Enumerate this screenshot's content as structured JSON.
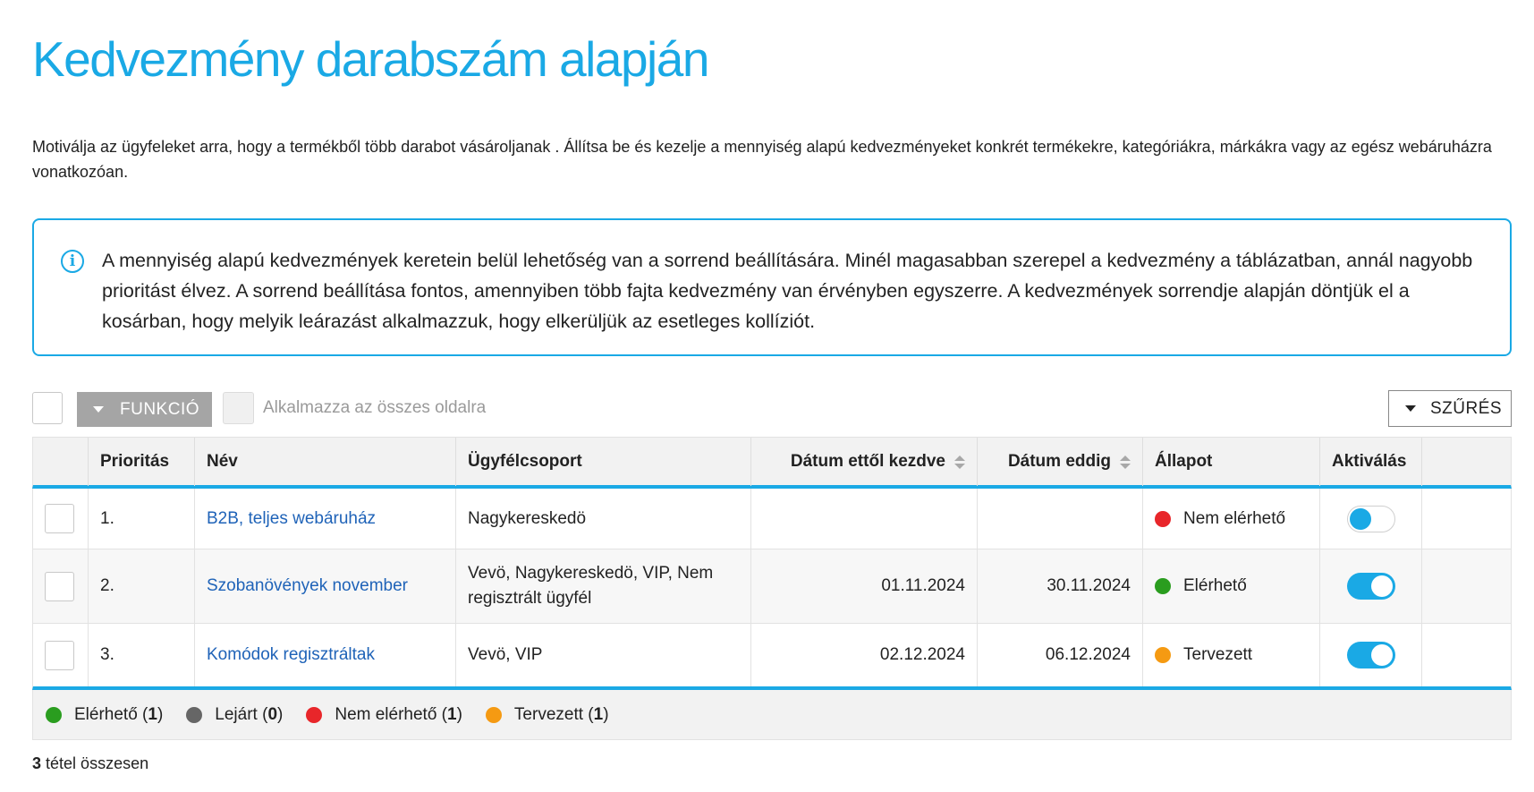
{
  "page": {
    "title": "Kedvezmény darabszám alapján",
    "intro": "Motiválja az ügyfeleket arra, hogy a termékből több darabot vásároljanak . Állítsa be és kezelje a mennyiség alapú kedvezményeket konkrét termékekre, kategóriákra, márkákra vagy az egész webáruházra vonatkozóan."
  },
  "info": {
    "icon": "info-circle-icon",
    "text": "A mennyiség alapú kedvezmények keretein belül lehetőség van a sorrend beállítására. Minél magasabban szerepel a kedvezmény a táblázatban, annál nagyobb prioritást élvez. A sorrend beállítása fontos, amennyiben több fajta kedvezmény van érvényben egyszerre. A kedvezmények sorrendje alapján döntjük el a kosárban, hogy melyik leárazást alkalmazzuk, hogy elkerüljük az esetleges kollíziót."
  },
  "toolbar": {
    "function_label": "FUNKCIÓ",
    "apply_all_label": "Alkalmazza az összes oldalra",
    "filter_label": "SZŰRÉS"
  },
  "table": {
    "headers": {
      "priority": "Prioritás",
      "name": "Név",
      "customer_group": "Ügyfélcsoport",
      "date_from": "Dátum ettől kezdve",
      "date_to": "Dátum eddig",
      "status": "Állapot",
      "activation": "Aktiválás"
    },
    "rows": [
      {
        "priority": "1.",
        "name": "B2B, teljes webáruház",
        "customer_group": "Nagykereskedö",
        "date_from": "",
        "date_to": "",
        "status": "Nem elérhető",
        "status_color": "#e8262a",
        "active": false
      },
      {
        "priority": "2.",
        "name": "Szobanövények november",
        "customer_group": "Vevö, Nagykereskedö, VIP, Nem regisztrált ügyfél",
        "date_from": "01.11.2024",
        "date_to": "30.11.2024",
        "status": "Elérhető",
        "status_color": "#2a9d1f",
        "active": true
      },
      {
        "priority": "3.",
        "name": "Komódok regisztráltak",
        "customer_group": "Vevö, VIP",
        "date_from": "02.12.2024",
        "date_to": "06.12.2024",
        "status": "Tervezett",
        "status_color": "#f59a12",
        "active": true
      }
    ]
  },
  "legend": [
    {
      "label": "Elérhető",
      "count": "1",
      "color": "#2a9d1f"
    },
    {
      "label": "Lejárt",
      "count": "0",
      "color": "#666666"
    },
    {
      "label": "Nem elérhető",
      "count": "1",
      "color": "#e8262a"
    },
    {
      "label": "Tervezett",
      "count": "1",
      "color": "#f59a12"
    }
  ],
  "summary": {
    "count": "3",
    "label": "tétel összesen"
  },
  "colors": {
    "accent": "#1aa9e5",
    "link": "#1f63b8"
  }
}
